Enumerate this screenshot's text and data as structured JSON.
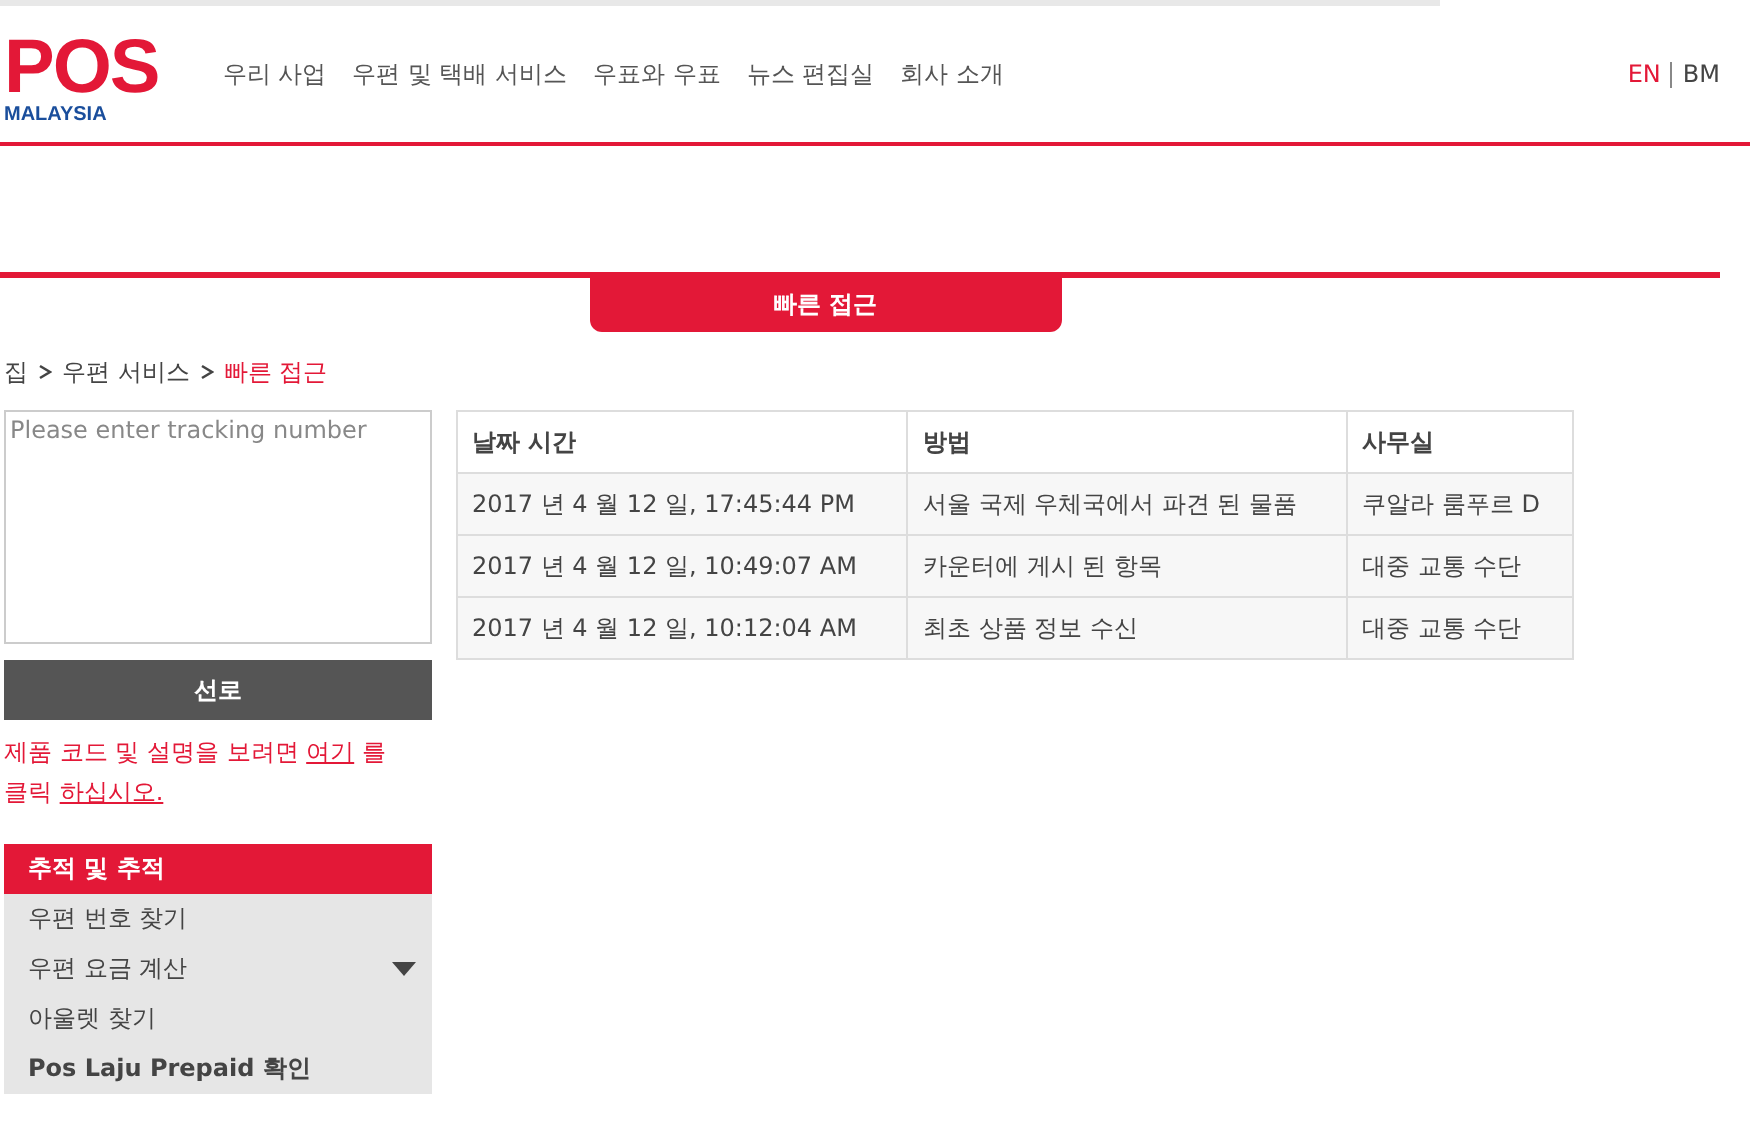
{
  "logo": {
    "mark": "POS",
    "sub": "MALAYSIA"
  },
  "nav": [
    "우리 사업",
    "우편 및 택배 서비스",
    "우표와 우표",
    "뉴스 편집실",
    "회사 소개"
  ],
  "languages": [
    {
      "label": "EN",
      "selected": true
    },
    {
      "label": "BM",
      "selected": false
    }
  ],
  "quick_access_tab": "빠른 접근",
  "breadcrumb": [
    {
      "label": "집",
      "selected": false
    },
    {
      "label": "우편 서비스",
      "selected": false
    },
    {
      "label": "빠른 접근",
      "selected": true
    }
  ],
  "tracking": {
    "placeholder": "Please enter tracking number",
    "button": "선로"
  },
  "hint": [
    {
      "text": "제품 코드 및 설명을 보려면",
      "link": false
    },
    {
      "text": "여기",
      "link": true
    },
    {
      "text": "를 클릭",
      "link": false
    },
    {
      "text": "하십시오.",
      "link": true
    }
  ],
  "menu": [
    {
      "label": "추적 및 추적",
      "selected": true,
      "kind": "plain",
      "expandable": false
    },
    {
      "label": "우편 번호 찾기",
      "selected": false,
      "kind": "plain",
      "expandable": false
    },
    {
      "label": "우편 요금 계산",
      "selected": false,
      "kind": "plain",
      "expandable": true
    },
    {
      "label": "아울렛 찾기",
      "selected": false,
      "kind": "plain",
      "expandable": false
    },
    {
      "label": "Pos Laju Prepaid 확인",
      "selected": false,
      "kind": "strong",
      "expandable": false
    }
  ],
  "table": {
    "columns": [
      "날짜 시간",
      "방법",
      "사무실"
    ],
    "rows": [
      [
        "2017 년 4 월 12 일, 17:45:44 PM",
        "서울 국제 우체국에서 파견 된 물품",
        "쿠알라 룸푸르 D"
      ],
      [
        "2017 년 4 월 12 일, 10:49:07 AM",
        "카운터에 게시 된 항목",
        "대중 교통 수단"
      ],
      [
        "2017 년 4 월 12 일, 10:12:04 AM",
        "최초 상품 정보 수신",
        "대중 교통 수단"
      ]
    ]
  }
}
